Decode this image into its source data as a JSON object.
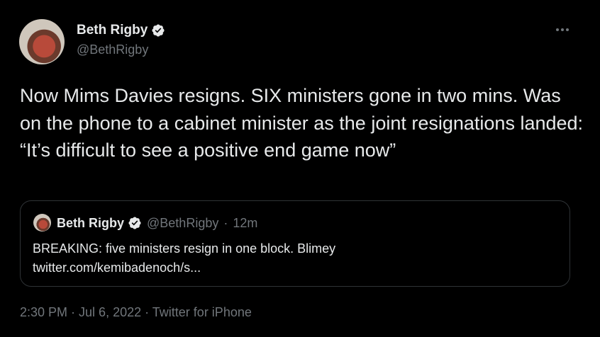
{
  "author": {
    "name": "Beth Rigby",
    "handle": "@BethRigby"
  },
  "tweet": {
    "text": "Now Mims Davies resigns. SIX ministers gone in two mins. Was on the phone to a cabinet minister as the joint resignations landed: “It’s difficult to see a positive end game now”"
  },
  "quote": {
    "name": "Beth Rigby",
    "handle": "@BethRigby",
    "separator": "·",
    "age": "12m",
    "text_line1": "BREAKING: five ministers resign in one block. Blimey",
    "text_line2": "twitter.com/kemibadenoch/s..."
  },
  "meta": {
    "time": "2:30 PM",
    "sep1": " · ",
    "date": "Jul 6, 2022",
    "sep2": " · ",
    "source": "Twitter for iPhone"
  },
  "icons": {
    "verified": "verified-badge-icon",
    "more": "more-options-icon"
  },
  "colors": {
    "background": "#000000",
    "text": "#e7e9ea",
    "secondary": "#71767b",
    "border": "#2f3336",
    "verified_badge": "#e7e9ea"
  }
}
